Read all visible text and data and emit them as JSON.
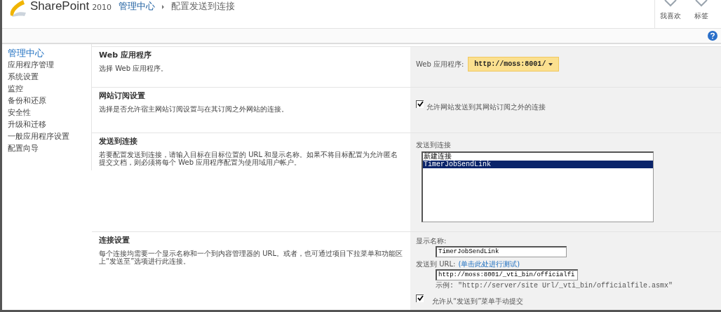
{
  "header": {
    "logo_text": "SharePoint",
    "logo_version": "2010",
    "breadcrumb": [
      "管理中心",
      "配置发送到连接"
    ],
    "actions": [
      {
        "label": "我喜欢"
      },
      {
        "label": "标签"
      }
    ]
  },
  "nav": {
    "title": "管理中心",
    "items": [
      {
        "label": "应用程序管理"
      },
      {
        "label": "系统设置"
      },
      {
        "label": "监控"
      },
      {
        "label": "备份和还原"
      },
      {
        "label": "安全性"
      },
      {
        "label": "升级和迁移"
      },
      {
        "label": "一般应用程序设置"
      },
      {
        "label": "配置向导"
      }
    ]
  },
  "sections": [
    {
      "kind": "dropdown",
      "title": "Web 应用程序",
      "description": "选择 Web 应用程序。",
      "label": "Web 应用程序:",
      "value": "http://moss:8001/"
    },
    {
      "kind": "checkbox",
      "title": "网站订阅设置",
      "description": "选择是否允许宿主网站订阅设置与在其订阅之外网站的连接。",
      "label": "允许网站发送到其网站订阅之外的连接",
      "checked": true
    },
    {
      "kind": "listbox",
      "title": "发送到连接",
      "description": "若要配置发送到连接，请输入目标在目标位置的 URL 和显示名称。如果不将目标配置为允许匿名提交文档，则必须将每个 Web 应用程序配置为使用域用户帐户。",
      "label": "发送到连接",
      "options": [
        {
          "label": "新建连接",
          "selected": false
        },
        {
          "label": "TimerJobSendLink",
          "selected": true
        }
      ]
    },
    {
      "kind": "connection",
      "title": "连接设置",
      "description": "每个连接均需要一个显示名称和一个到内容管理器的 URL。或者，也可通过项目下拉菜单和功能区上“发送至”选项进行此连接。",
      "name_label": "显示名称:",
      "name_value": "TimerJobSendLink",
      "url_label": "发送到 URL:",
      "test_link": "(单击此处进行测试)",
      "url_value": "http://moss:8001/_vti_bin/officialfi",
      "example": "示例: \"http://server/site Url/_vti_bin/officialfile.asmx\"",
      "manual_label": "允许从“发送到”菜单手动提交",
      "manual_checked": true
    }
  ]
}
